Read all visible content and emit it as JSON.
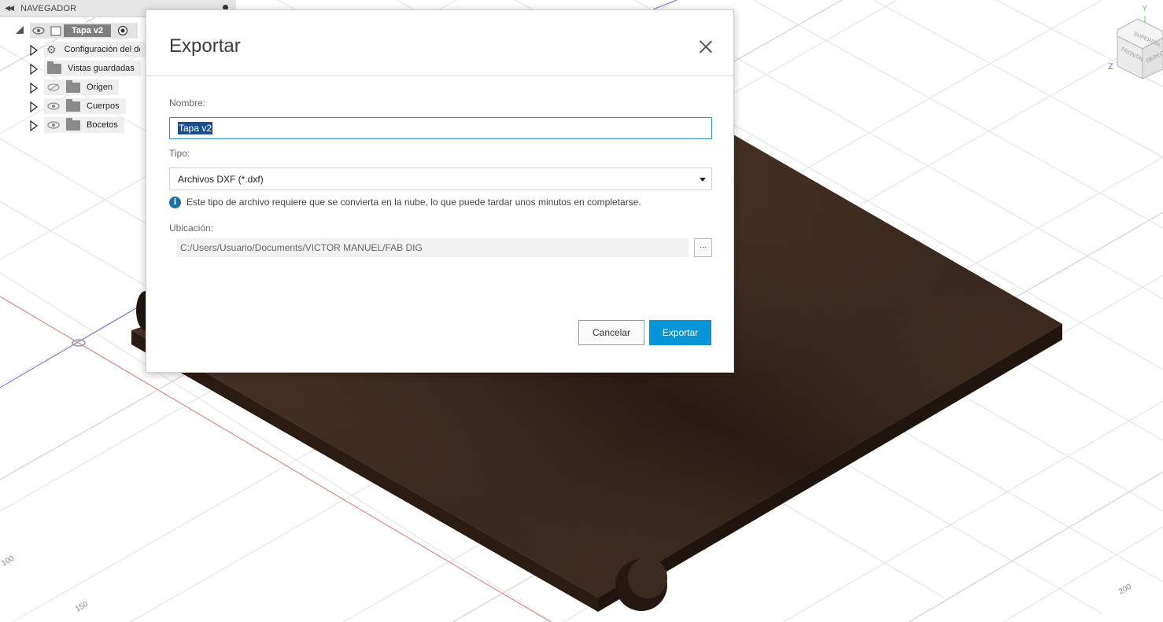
{
  "navigator": {
    "title": "NAVEGADOR",
    "root": "Tapa v2",
    "items": [
      {
        "label": "Configuración del do"
      },
      {
        "label": "Vistas guardadas"
      },
      {
        "label": "Origen"
      },
      {
        "label": "Cuerpos"
      },
      {
        "label": "Bocetos"
      }
    ]
  },
  "dialog": {
    "title": "Exportar",
    "name_label": "Nombre:",
    "name_value": "Tapa v2",
    "type_label": "Tipo:",
    "type_value": "Archivos DXF (*.dxf)",
    "info": "Este tipo de archivo requiere que se convierta en la nube, lo que puede tardar unos minutos en completarse.",
    "info_icon": "i",
    "location_label": "Ubicación:",
    "location_value": "C:/Users/Usuario/Documents/VICTOR MANUEL/FAB DIG",
    "browse_label": "...",
    "cancel_label": "Cancelar",
    "export_label": "Exportar",
    "accent_color": "#0696d7"
  },
  "viewcube": {
    "faces": [
      "SUPERIOR",
      "FRONTAL",
      "DERECHA"
    ],
    "axes": [
      "Y",
      "Z"
    ]
  },
  "grid_labels": [
    "100",
    "150",
    "200"
  ]
}
